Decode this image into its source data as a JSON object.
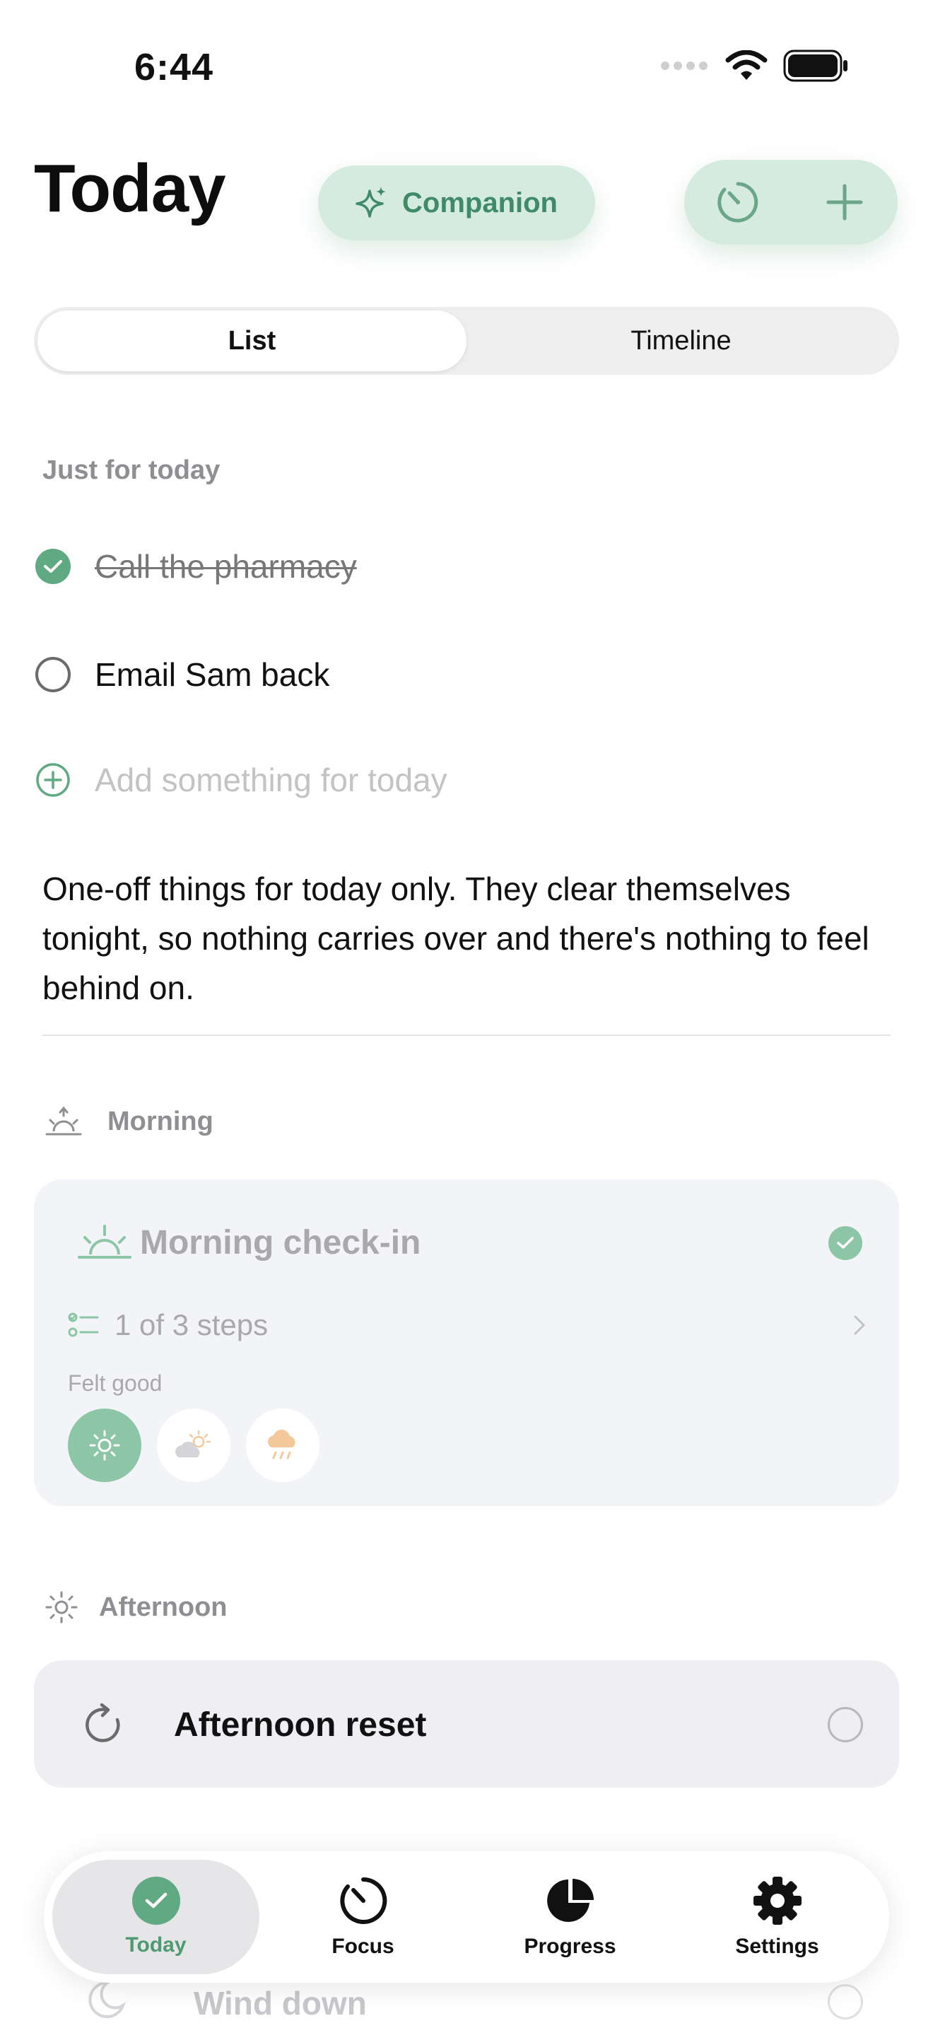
{
  "status_bar": {
    "time": "6:44"
  },
  "header": {
    "title": "Today",
    "companion_label": "Companion"
  },
  "segmented": {
    "list_label": "List",
    "timeline_label": "Timeline",
    "selected": "List"
  },
  "just_for_today": {
    "section_label": "Just for today",
    "items": [
      {
        "label": "Call the pharmacy",
        "done": true
      },
      {
        "label": "Email Sam back",
        "done": false
      }
    ],
    "add_placeholder": "Add something for today",
    "explanation": "One-off things for today only. They clear themselves tonight, so nothing carries over and there's nothing to feel behind on."
  },
  "morning": {
    "group_label": "Morning",
    "card_title": "Morning check-in",
    "steps_label": "1 of 3 steps",
    "mood_label": "Felt good",
    "moods": [
      "sunny-icon",
      "partly-cloudy-icon",
      "rainy-icon"
    ],
    "selected_mood": "sunny-icon",
    "completed": true
  },
  "afternoon": {
    "group_label": "Afternoon",
    "card_title": "Afternoon reset",
    "completed": false
  },
  "evening": {
    "card_title": "Wind down"
  },
  "tabbar": {
    "tabs": [
      {
        "label": "Today",
        "icon": "checkmark-circle-icon"
      },
      {
        "label": "Focus",
        "icon": "timer-icon"
      },
      {
        "label": "Progress",
        "icon": "pie-chart-icon"
      },
      {
        "label": "Settings",
        "icon": "gear-icon"
      }
    ],
    "active": "Today"
  },
  "colors": {
    "accent": "#5fa983",
    "accent_light": "#d6ebe0",
    "text_muted": "#8e8e93"
  }
}
